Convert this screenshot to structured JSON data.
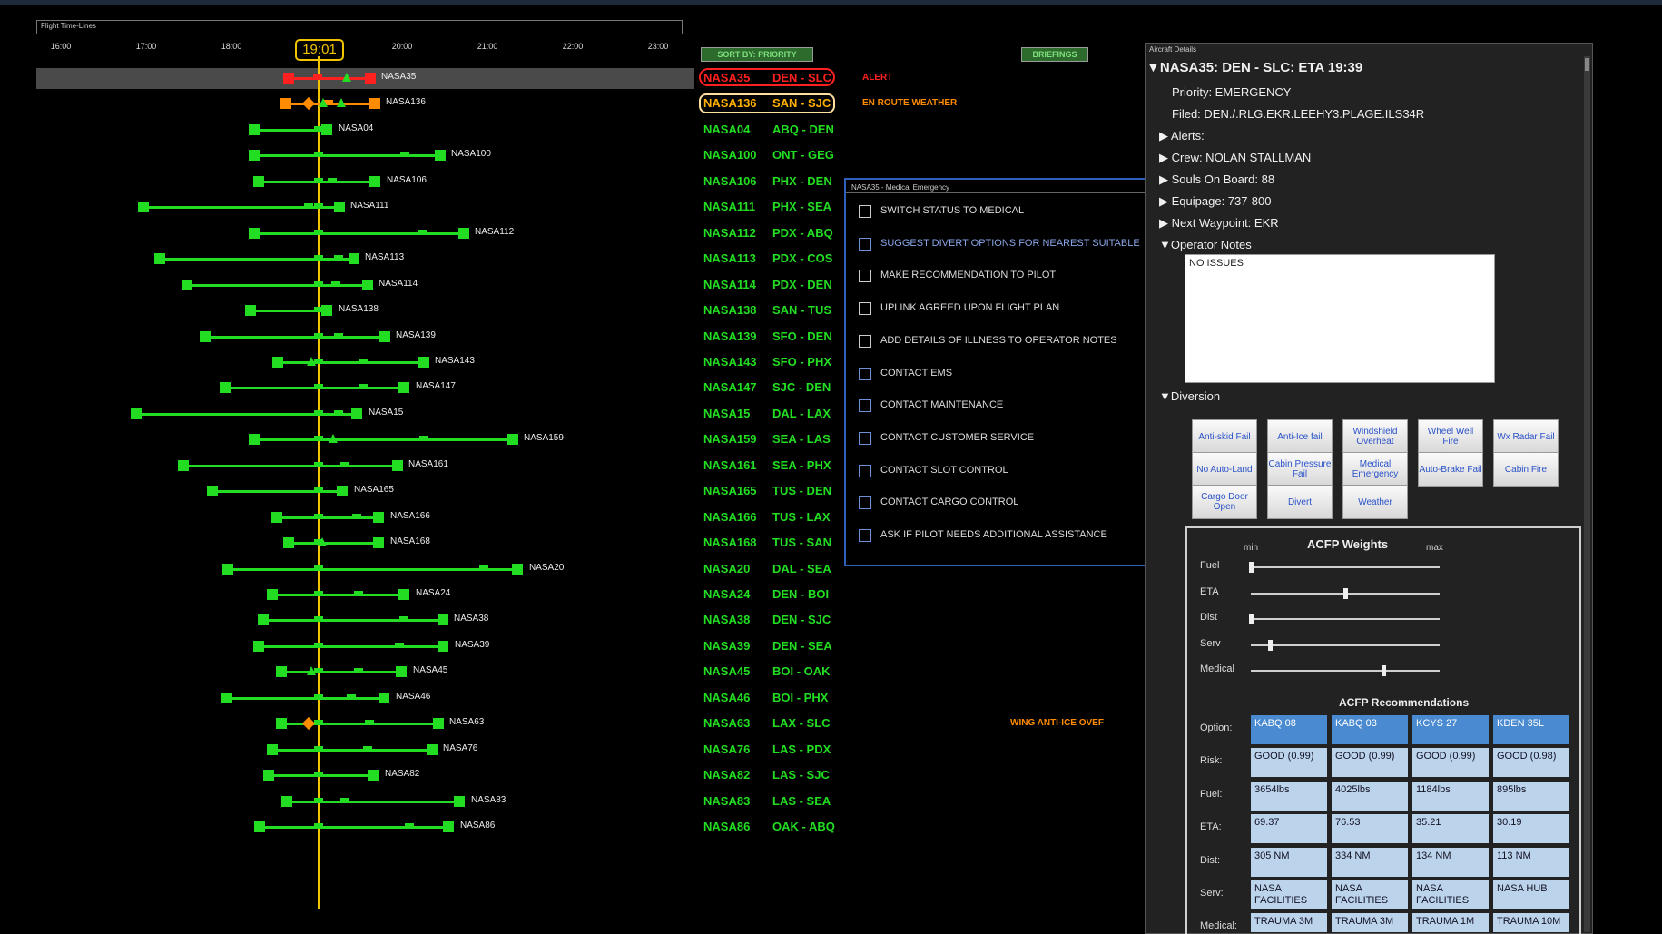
{
  "timeline": {
    "title": "Flight Time-Lines",
    "hours": [
      "16:00",
      "17:00",
      "18:00",
      "19:00",
      "20:00",
      "21:00",
      "22:00",
      "23:00"
    ],
    "current_time": "19:01"
  },
  "toolbar": {
    "sort_label": "SORT BY: PRIORITY",
    "briefings_label": "BRIEFINGS"
  },
  "colors": {
    "green": "#22dd22",
    "red": "#ff2020",
    "orange": "#ff8c00",
    "timeline_accent": "#f2c400",
    "panel_blue": "#2f5fb8"
  },
  "flights": [
    {
      "id": "NASA35",
      "route": "DEN - SLC",
      "status": "ALERT",
      "color": "red"
    },
    {
      "id": "NASA136",
      "route": "SAN - SJC",
      "status": "EN ROUTE WEATHER",
      "color": "orange"
    },
    {
      "id": "NASA04",
      "route": "ABQ - DEN",
      "status": "",
      "color": "green"
    },
    {
      "id": "NASA100",
      "route": "ONT - GEG",
      "status": "",
      "color": "green"
    },
    {
      "id": "NASA106",
      "route": "PHX - DEN",
      "status": "",
      "color": "green"
    },
    {
      "id": "NASA111",
      "route": "PHX - SEA",
      "status": "",
      "color": "green"
    },
    {
      "id": "NASA112",
      "route": "PDX - ABQ",
      "status": "",
      "color": "green"
    },
    {
      "id": "NASA113",
      "route": "PDX - COS",
      "status": "",
      "color": "green"
    },
    {
      "id": "NASA114",
      "route": "PDX - DEN",
      "status": "",
      "color": "green"
    },
    {
      "id": "NASA138",
      "route": "SAN - TUS",
      "status": "",
      "color": "green"
    },
    {
      "id": "NASA139",
      "route": "SFO - DEN",
      "status": "",
      "color": "green"
    },
    {
      "id": "NASA143",
      "route": "SFO - PHX",
      "status": "",
      "color": "green"
    },
    {
      "id": "NASA147",
      "route": "SJC - DEN",
      "status": "",
      "color": "green"
    },
    {
      "id": "NASA15",
      "route": "DAL - LAX",
      "status": "",
      "color": "green"
    },
    {
      "id": "NASA159",
      "route": "SEA - LAS",
      "status": "",
      "color": "green"
    },
    {
      "id": "NASA161",
      "route": "SEA - PHX",
      "status": "",
      "color": "green"
    },
    {
      "id": "NASA165",
      "route": "TUS - DEN",
      "status": "",
      "color": "green"
    },
    {
      "id": "NASA166",
      "route": "TUS - LAX",
      "status": "",
      "color": "green"
    },
    {
      "id": "NASA168",
      "route": "TUS - SAN",
      "status": "",
      "color": "green"
    },
    {
      "id": "NASA20",
      "route": "DAL - SEA",
      "status": "",
      "color": "green"
    },
    {
      "id": "NASA24",
      "route": "DEN - BOI",
      "status": "",
      "color": "green"
    },
    {
      "id": "NASA38",
      "route": "DEN - SJC",
      "status": "",
      "color": "green"
    },
    {
      "id": "NASA39",
      "route": "DEN - SEA",
      "status": "",
      "color": "green"
    },
    {
      "id": "NASA45",
      "route": "BOI - OAK",
      "status": "",
      "color": "green"
    },
    {
      "id": "NASA46",
      "route": "BOI - PHX",
      "status": "",
      "color": "green"
    },
    {
      "id": "NASA63",
      "route": "LAX - SLC",
      "status": "WING ANTI-ICE OVEF",
      "color": "green"
    },
    {
      "id": "NASA76",
      "route": "LAS - PDX",
      "status": "",
      "color": "green"
    },
    {
      "id": "NASA82",
      "route": "LAS - SJC",
      "status": "",
      "color": "green"
    },
    {
      "id": "NASA83",
      "route": "LAS - SEA",
      "status": "",
      "color": "green"
    },
    {
      "id": "NASA86",
      "route": "OAK - ABQ",
      "status": "",
      "color": "green"
    }
  ],
  "medical_panel": {
    "title": "NASA35 - Medical Emergency",
    "items": [
      "SWITCH STATUS TO MEDICAL",
      "SUGGEST DIVERT OPTIONS FOR NEAREST SUITABLE",
      "MAKE RECOMMENDATION TO PILOT",
      "UPLINK AGREED UPON FLIGHT PLAN",
      "ADD DETAILS OF ILLNESS TO OPERATOR NOTES",
      "CONTACT EMS",
      "CONTACT MAINTENANCE",
      "CONTACT CUSTOMER SERVICE",
      "CONTACT SLOT CONTROL",
      "CONTACT CARGO CONTROL",
      "ASK IF PILOT NEEDS ADDITIONAL ASSISTANCE"
    ]
  },
  "details": {
    "panel_title": "Aircraft Details",
    "header": "NASA35: DEN - SLC: ETA 19:39",
    "priority": "Priority: EMERGENCY",
    "filed": "Filed: DEN./.RLG.EKR.LEEHY3.PLAGE.ILS34R",
    "alerts": "Alerts:",
    "crew": "Crew: NOLAN STALLMAN",
    "souls": "Souls On Board: 88",
    "equipage": "Equipage: 737-800",
    "next_waypoint": "Next Waypoint: EKR",
    "operator_notes_label": "Operator Notes",
    "operator_notes": "NO ISSUES",
    "diversion_label": "Diversion",
    "diversion_buttons": [
      "Anti-skid Fail",
      "Anti-Ice fail",
      "Windshield Overheat",
      "Wheel Well Fire",
      "Wx Radar Fail",
      "No Auto-Land",
      "Cabin Pressure Fail",
      "Medical Emergency",
      "Auto-Brake Fail",
      "Cabin Fire",
      "Cargo Door Open",
      "Divert",
      "Weather"
    ],
    "weights": {
      "title": "ACFP Weights",
      "min": "min",
      "max": "max",
      "labels": [
        "Fuel",
        "ETA",
        "Dist",
        "Serv",
        "Medical"
      ],
      "levels": [
        0.0,
        0.5,
        0.0,
        0.1,
        0.7
      ]
    },
    "recommendations": {
      "title": "ACFP Recommendations",
      "row_labels": [
        "Option:",
        "Risk:",
        "Fuel:",
        "ETA:",
        "Dist:",
        "Serv:",
        "Medical:"
      ],
      "columns": [
        [
          "KABQ 08",
          "GOOD (0.99)",
          "3654lbs",
          "69.37",
          "305 NM",
          "NASA FACILITIES",
          "TRAUMA 3M"
        ],
        [
          "KABQ 03",
          "GOOD (0.99)",
          "4025lbs",
          "76.53",
          "334 NM",
          "NASA FACILITIES",
          "TRAUMA 3M"
        ],
        [
          "KCYS 27",
          "GOOD (0.99)",
          "1184lbs",
          "35.21",
          "134 NM",
          "NASA FACILITIES",
          "TRAUMA 1M"
        ],
        [
          "KDEN 35L",
          "GOOD (0.98)",
          "895lbs",
          "30.19",
          "113 NM",
          "NASA HUB",
          "TRAUMA 10M"
        ]
      ]
    }
  }
}
